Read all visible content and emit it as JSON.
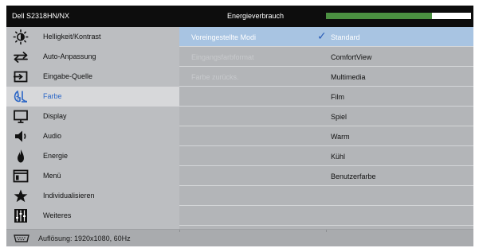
{
  "header": {
    "model": "Dell S2318HN/NX",
    "energy_label": "Energieverbrauch",
    "energy_level_fraction": 0.73,
    "energy_fill_color": "#4b8f41"
  },
  "sidebar": {
    "items": [
      {
        "label": "Helligkeit/Kontrast",
        "icon": "brightness-icon"
      },
      {
        "label": "Auto-Anpassung",
        "icon": "auto-adjust-icon"
      },
      {
        "label": "Eingabe-Quelle",
        "icon": "input-source-icon"
      },
      {
        "label": "Farbe",
        "icon": "color-palette-icon",
        "active": true
      },
      {
        "label": "Display",
        "icon": "monitor-icon"
      },
      {
        "label": "Audio",
        "icon": "speaker-icon"
      },
      {
        "label": "Energie",
        "icon": "power-leaf-icon"
      },
      {
        "label": "Menü",
        "icon": "menu-icon"
      },
      {
        "label": "Individualisieren",
        "icon": "star-icon"
      },
      {
        "label": "Weiteres",
        "icon": "sliders-icon"
      }
    ]
  },
  "panel": {
    "left_options": [
      {
        "label": "Voreingestellte Modi",
        "state": "active"
      },
      {
        "label": "Eingangsfarbformat",
        "state": "disabled"
      },
      {
        "label": "Farbe zurücks.",
        "state": "disabled"
      }
    ],
    "preset_modes": [
      {
        "label": "Standard",
        "selected": true
      },
      {
        "label": "ComfortView"
      },
      {
        "label": "Multimedia"
      },
      {
        "label": "Film"
      },
      {
        "label": "Spiel"
      },
      {
        "label": "Warm"
      },
      {
        "label": "Kühl"
      },
      {
        "label": "Benutzerfarbe"
      }
    ],
    "selected_color": "#a8c4e2",
    "check_icon": "checkmark-icon"
  },
  "footer": {
    "connector_icon": "vga-connector-icon",
    "resolution": "Auflösung: 1920x1080, 60Hz"
  }
}
